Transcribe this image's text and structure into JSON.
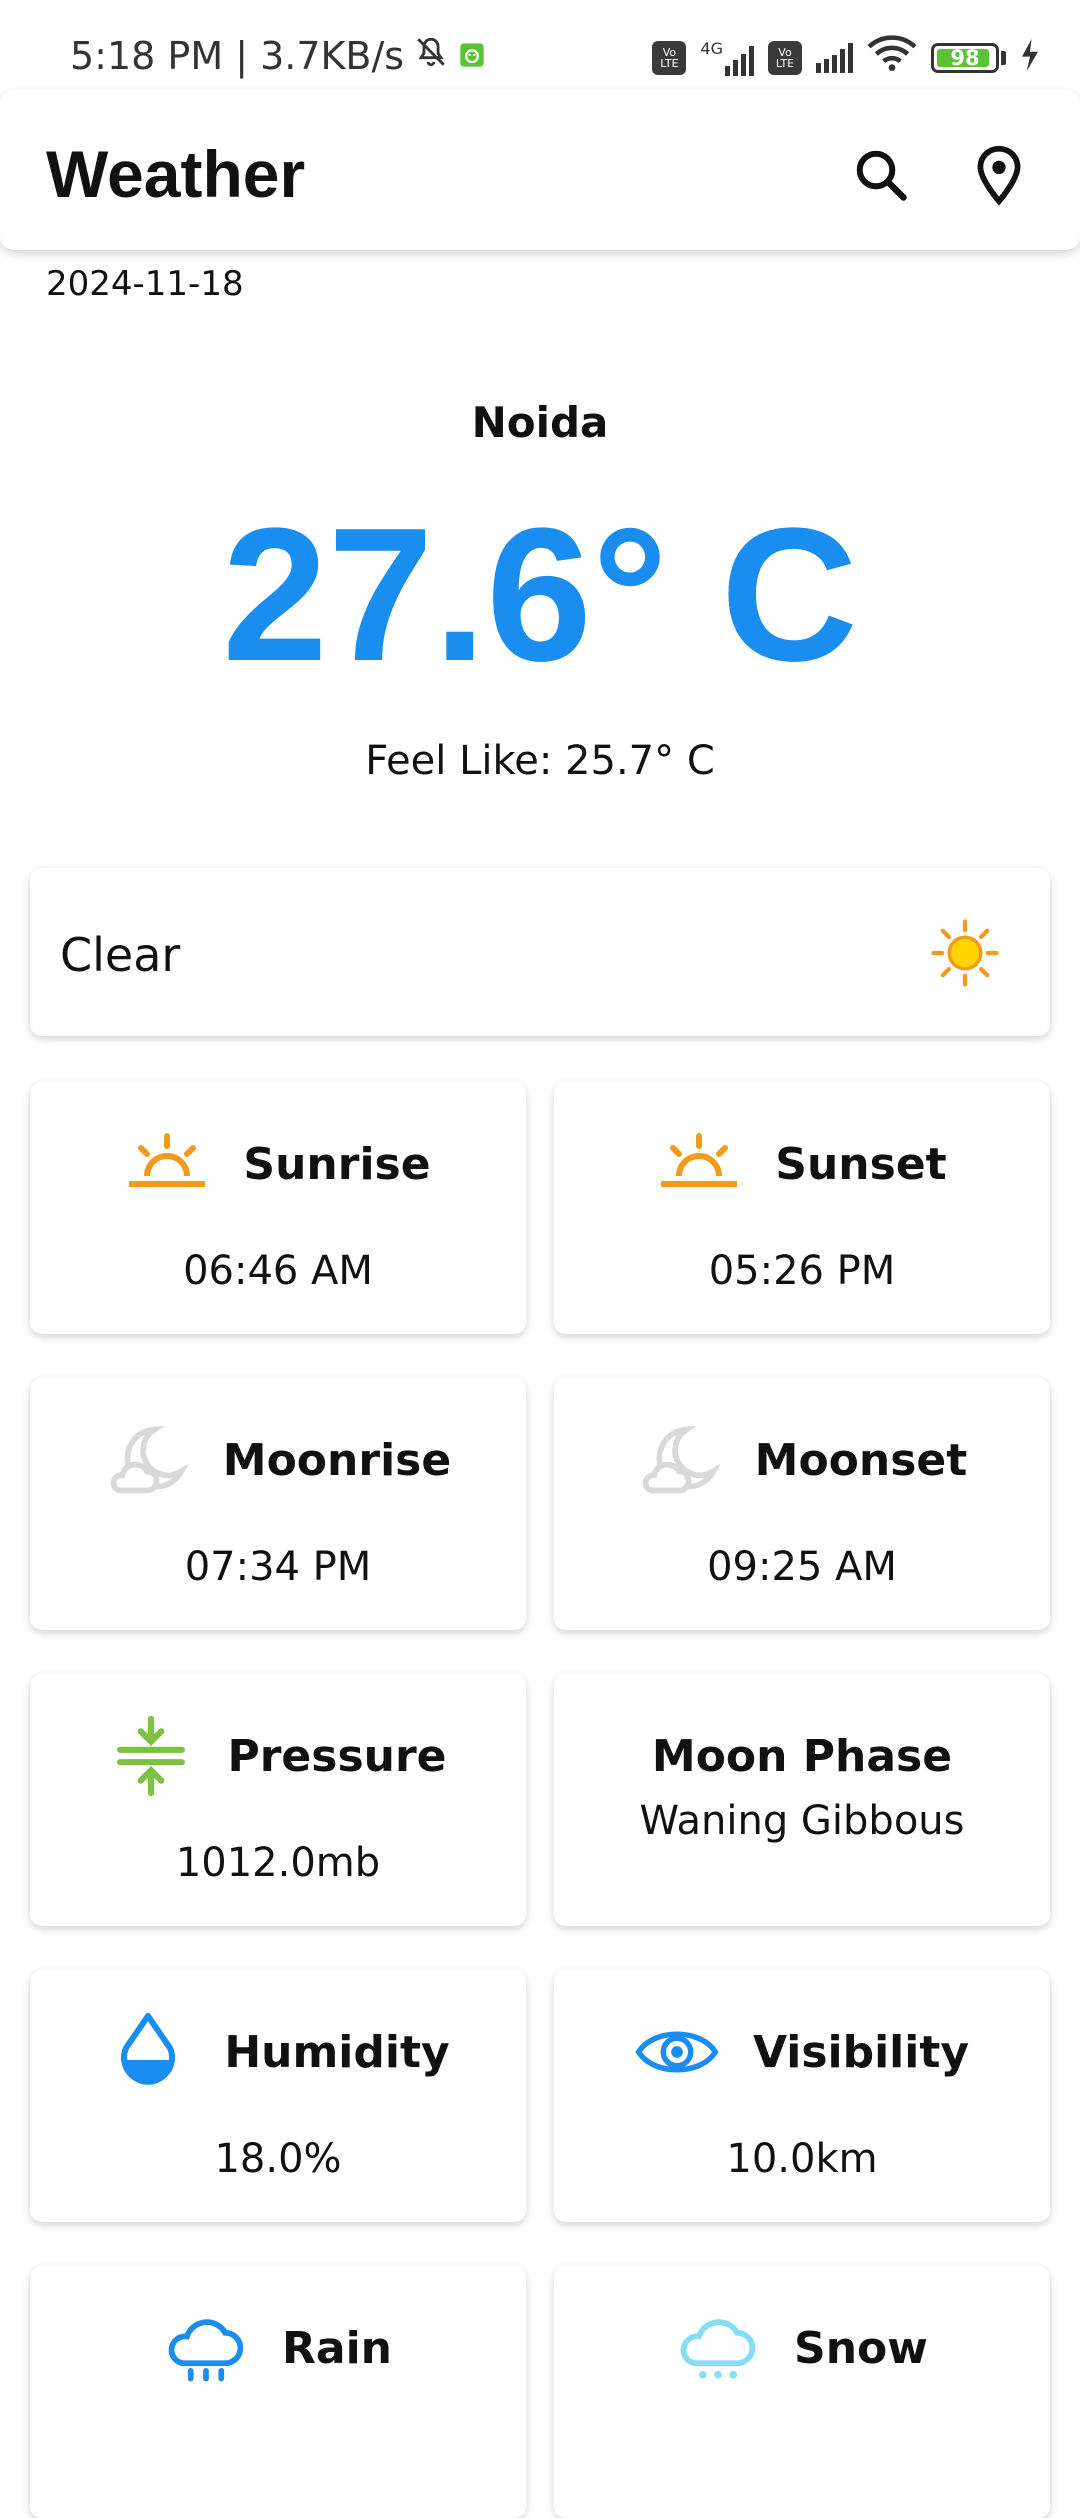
{
  "status_bar": {
    "time_speed": "5:18 PM | 3.7KB/s",
    "network_type": "4G",
    "volte_label": "Vo LTE",
    "battery_level": "98",
    "icons": [
      "mute-bell-icon",
      "app-notification-icon",
      "volte-icon",
      "cellular-signal-icon",
      "wifi-icon",
      "battery-icon",
      "charging-icon"
    ]
  },
  "app_bar": {
    "title": "Weather",
    "actions": [
      "search-icon",
      "location-pin-icon"
    ]
  },
  "weather": {
    "date": "2024-11-18",
    "city": "Noida",
    "temperature": "27.6° C",
    "feels_like": "Feel Like: 25.7° C",
    "condition": "Clear",
    "condition_icon": "sun-icon"
  },
  "tiles": [
    {
      "title": "Sunrise",
      "value": "06:46 AM",
      "icon": "sunrise-icon"
    },
    {
      "title": "Sunset",
      "value": "05:26 PM",
      "icon": "sunset-icon"
    },
    {
      "title": "Moonrise",
      "value": "07:34 PM",
      "icon": "moon-cloud-icon"
    },
    {
      "title": "Moonset",
      "value": "09:25 AM",
      "icon": "moon-cloud-icon"
    },
    {
      "title": "Pressure",
      "value": "1012.0mb",
      "icon": "pressure-icon"
    },
    {
      "title": "Moon Phase",
      "value": "Waning Gibbous"
    },
    {
      "title": "Humidity",
      "value": "18.0%",
      "icon": "water-drop-icon"
    },
    {
      "title": "Visibility",
      "value": "10.0km",
      "icon": "eye-icon"
    },
    {
      "title": "Rain",
      "icon": "rain-cloud-icon"
    },
    {
      "title": "Snow",
      "icon": "snow-cloud-icon"
    }
  ],
  "colors": {
    "accent_blue": "#1a8ef0",
    "sun_orange": "#f39a1b",
    "pressure_green": "#7cc142",
    "moon_gray": "#d9d9d9",
    "snow_light_blue": "#87dcf6",
    "battery_green": "#5bc236"
  }
}
